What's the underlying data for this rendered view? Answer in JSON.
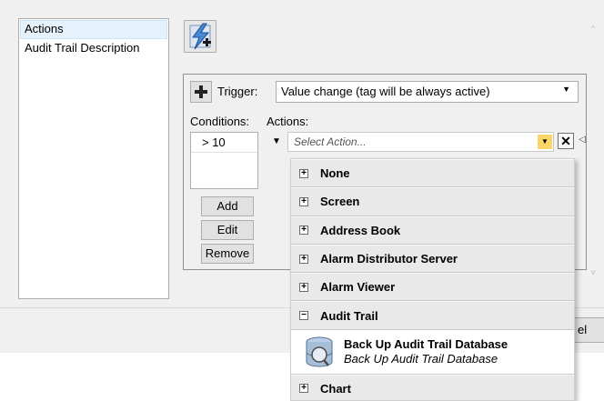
{
  "left_list": {
    "items": [
      {
        "label": "Actions",
        "selected": true
      },
      {
        "label": "Audit Trail Description",
        "selected": false
      }
    ]
  },
  "lightning_button": {
    "icon": "lightning-add-icon"
  },
  "trigger": {
    "add_icon": "plus-icon",
    "label": "Trigger:",
    "value": "Value change (tag will be always active)"
  },
  "conditions": {
    "label": "Conditions:",
    "items": [
      "> 10"
    ],
    "add_label": "Add",
    "edit_label": "Edit",
    "remove_label": "Remove"
  },
  "actions": {
    "label": "Actions:",
    "placeholder": "Select Action...",
    "delete_icon": "close-icon"
  },
  "dropdown": {
    "groups_before": [
      "None",
      "Screen",
      "Address Book",
      "Alarm Distributor Server",
      "Alarm Viewer"
    ],
    "expanded_group": "Audit Trail",
    "expanded_items": [
      {
        "title": "Back Up Audit Trail Database",
        "subtitle": "Back Up Audit Trail Database",
        "icon": "database-backup-icon"
      }
    ],
    "groups_after": [
      "Chart"
    ]
  },
  "footer": {
    "cancel_label_partial": "el"
  },
  "colors": {
    "selected_bg": "#e5f1fb",
    "drop_button": "#fbd567",
    "panel_bg": "#f0f0f0"
  }
}
